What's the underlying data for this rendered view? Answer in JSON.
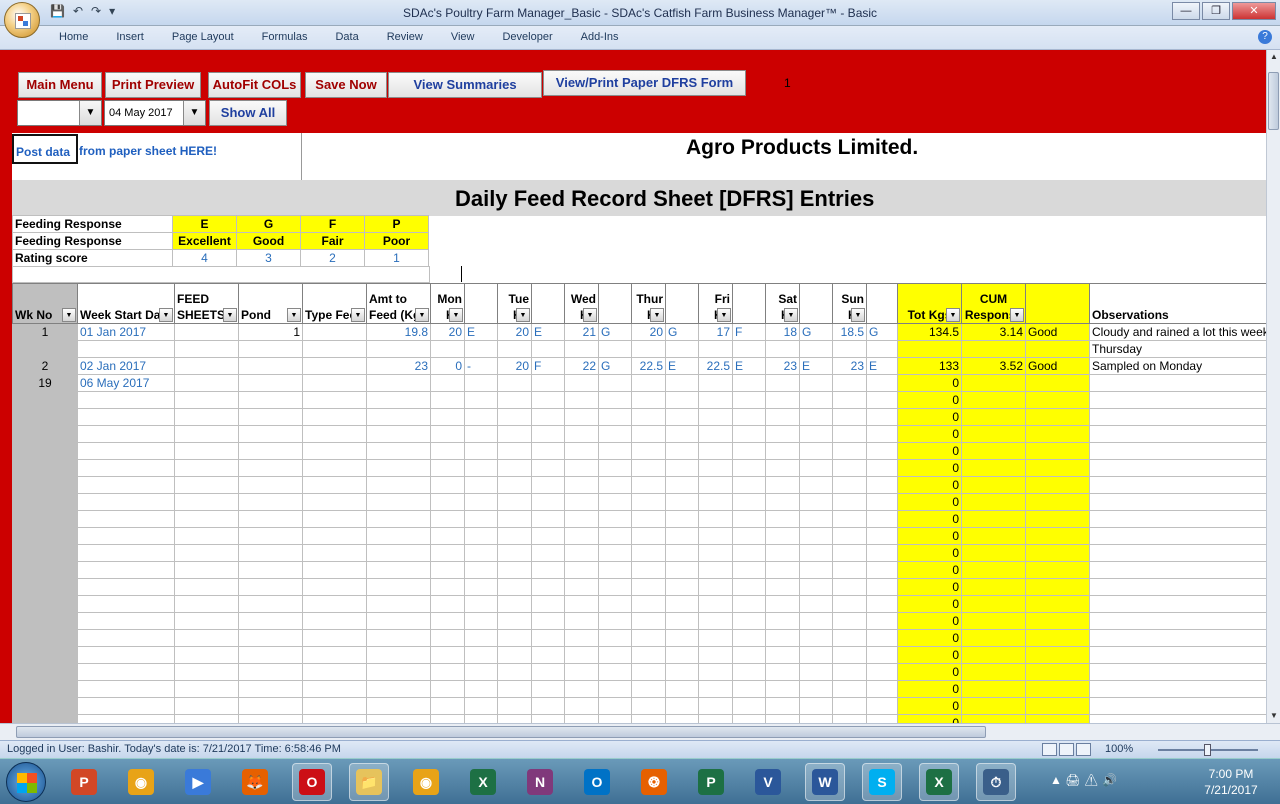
{
  "window": {
    "title": "SDAc's Poultry Farm Manager_Basic - SDAc's Catfish Farm Business Manager™ - Basic",
    "qat_items": [
      "💾",
      "↶",
      "↷",
      "▾"
    ],
    "controls": {
      "minimize": "—",
      "restore": "❐",
      "close": "✕"
    }
  },
  "ribbon": {
    "tabs": [
      "Home",
      "Insert",
      "Page Layout",
      "Formulas",
      "Data",
      "Review",
      "View",
      "Developer",
      "Add-Ins"
    ],
    "help": "?"
  },
  "toolbar": {
    "main_menu": "Main Menu",
    "print_preview": "Print Preview",
    "autofit": "AutoFit COLs",
    "save_now": "Save Now",
    "view_summaries": "View Summaries",
    "view_print": "View/Print Paper DFRS Form",
    "counter": "1",
    "dropdown1_value": "",
    "date_value": "04 May 2017",
    "show_all": "Show All"
  },
  "sheet": {
    "post_data_cell": "Post data",
    "post_data_rest": "from paper sheet HERE!",
    "company": "Agro Products Limited.",
    "title": "Daily Feed Record Sheet [DFRS] Entries"
  },
  "legend": {
    "rows": [
      {
        "label": "Feeding Response",
        "cells": [
          "E",
          "G",
          "F",
          "P"
        ]
      },
      {
        "label": "Feeding Response",
        "cells": [
          "Excellent",
          "Good",
          "Fair",
          "Poor"
        ]
      },
      {
        "label": "Rating score",
        "cells": [
          "4",
          "3",
          "2",
          "1"
        ]
      }
    ]
  },
  "table": {
    "headers": [
      "Wk No",
      "Week Start Date",
      "FEED SHEETS",
      "Pond",
      "Type Feed",
      "Amt to Feed (Kg)",
      "Mon Kg",
      "",
      "Tue Kg",
      "",
      "Wed Kg",
      "",
      "Thur Kg",
      "",
      "Fri Kg",
      "",
      "Sat Kg",
      "",
      "Sun Kg",
      "",
      "Tot Kgs",
      "CUM Response",
      "",
      "Observations"
    ],
    "rows": [
      [
        "1",
        "01 Jan 2017",
        "",
        "1",
        "",
        "19.8",
        "20",
        "E",
        "20",
        "E",
        "21",
        "G",
        "20",
        "G",
        "17",
        "F",
        "18",
        "G",
        "18.5",
        "G",
        "134.5",
        "3.14",
        "Good",
        "Cloudy and rained a lot this week"
      ],
      [
        "",
        "",
        "",
        "",
        "",
        "",
        "",
        "",
        "",
        "",
        "",
        "",
        "",
        "",
        "",
        "",
        "",
        "",
        "",
        "",
        "",
        "",
        "",
        "Thursday"
      ],
      [
        "2",
        "02 Jan 2017",
        "",
        "",
        "",
        "23",
        "0",
        "-",
        "20",
        "F",
        "22",
        "G",
        "22.5",
        "E",
        "22.5",
        "E",
        "23",
        "E",
        "23",
        "E",
        "133",
        "3.52",
        "Good",
        "Sampled on Monday"
      ],
      [
        "19",
        "06 May 2017",
        "",
        "",
        "",
        "",
        "",
        "",
        "",
        "",
        "",
        "",
        "",
        "",
        "",
        "",
        "",
        "",
        "",
        "",
        "0",
        "",
        "",
        ""
      ]
    ],
    "empty_tot_values": [
      "0",
      "0",
      "0",
      "0",
      "0",
      "0",
      "0",
      "0",
      "0",
      "0",
      "0",
      "0",
      "0",
      "0",
      "0",
      "0",
      "0",
      "0",
      "0",
      "0"
    ]
  },
  "status": {
    "text": "Logged in User: Bashir.        Today's date is: 7/21/2017 Time: 6:58:46 PM",
    "zoom": "100%",
    "zoom_level_percent": 100
  },
  "taskbar": {
    "apps": [
      "P",
      "◉",
      "▶",
      "🦊",
      "O",
      "📁",
      "◉",
      "X",
      "N",
      "O",
      "❂",
      "P",
      "V",
      "W",
      "S",
      "X",
      "⏱"
    ],
    "time": "7:00 PM",
    "date": "7/21/2017"
  }
}
